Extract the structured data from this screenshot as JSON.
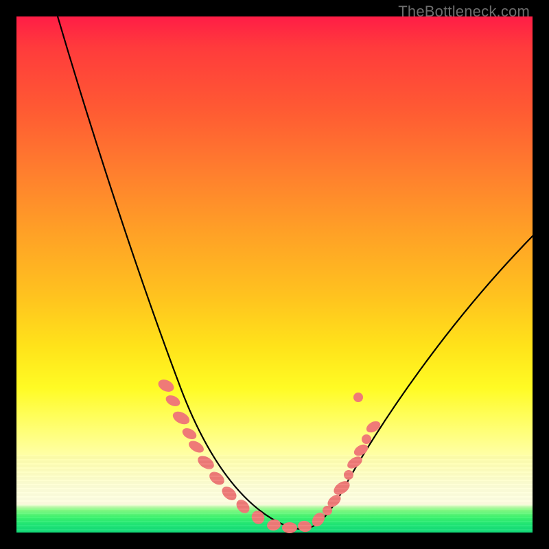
{
  "watermark": "TheBottleneck.com",
  "chart_data": {
    "type": "line",
    "title": "",
    "xlabel": "",
    "ylabel": "",
    "xlim": [
      0,
      100
    ],
    "ylim": [
      0,
      100
    ],
    "series": [
      {
        "name": "bottleneck-curve",
        "x": [
          8,
          12,
          18,
          24,
          29,
          33,
          37,
          40,
          43,
          46,
          49,
          52,
          55,
          58,
          62,
          66,
          72,
          80,
          90,
          100
        ],
        "y": [
          100,
          88,
          74,
          62,
          52,
          43,
          34,
          26,
          18,
          10,
          4,
          1,
          0,
          1,
          6,
          14,
          25,
          38,
          50,
          58
        ]
      }
    ],
    "markers": {
      "name": "highlight-points",
      "color": "#ef7a77",
      "points_xy": [
        [
          29,
          28
        ],
        [
          30,
          25
        ],
        [
          32,
          22
        ],
        [
          33,
          20
        ],
        [
          34,
          18
        ],
        [
          36,
          14
        ],
        [
          38,
          11
        ],
        [
          40,
          8
        ],
        [
          42,
          6
        ],
        [
          45,
          3
        ],
        [
          48,
          1.5
        ],
        [
          50,
          1
        ],
        [
          53,
          0.4
        ],
        [
          55,
          0.2
        ],
        [
          57,
          0.6
        ],
        [
          59,
          2
        ],
        [
          60,
          4
        ],
        [
          62,
          8
        ],
        [
          63,
          11
        ],
        [
          64,
          14
        ],
        [
          65,
          17
        ],
        [
          66,
          20
        ],
        [
          67,
          22
        ]
      ]
    },
    "background_gradient_note": "vertical red→orange→yellow→cream→green"
  }
}
